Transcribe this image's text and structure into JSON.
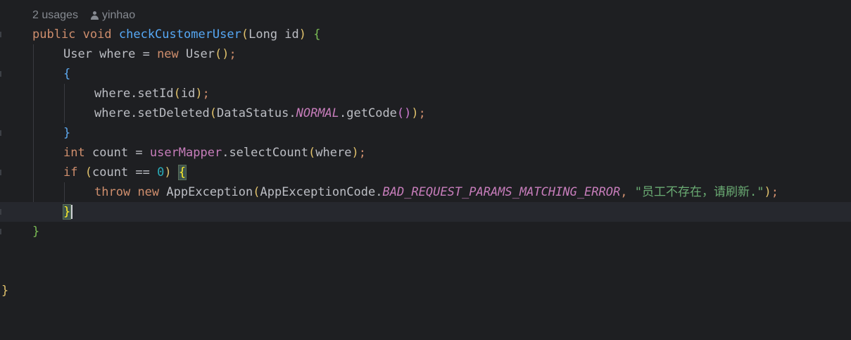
{
  "inlay_hint": {
    "usages": "2 usages",
    "author": "yinhao",
    "author_icon": "person-icon"
  },
  "code_lines": [
    [
      "public",
      " ",
      "void",
      " ",
      "checkCustomerUser",
      "(",
      "Long id",
      ")",
      " ",
      "{"
    ],
    [
      "User where = ",
      "new",
      " ",
      "User",
      "(",
      ")",
      ";"
    ],
    [
      "{"
    ],
    [
      "where.setId",
      "(",
      "id",
      ")",
      ";"
    ],
    [
      "where.setDeleted",
      "(",
      "DataStatus.",
      "NORMAL",
      ".getCode",
      "(",
      ")",
      ")",
      ";"
    ],
    [
      "}"
    ],
    [
      "int",
      " count = ",
      "userMapper",
      ".selectCount",
      "(",
      "where",
      ")",
      ";"
    ],
    [
      "if",
      " ",
      "(",
      "count == ",
      "0",
      ")",
      " ",
      "{"
    ],
    [
      "throw",
      " ",
      "new",
      " ",
      "AppException",
      "(",
      "AppExceptionCode.",
      "BAD_REQUEST_PARAMS_MATCHING_ERROR",
      ", ",
      "\"员工不存在，请刷新.\"",
      ")",
      ";"
    ],
    [
      "}"
    ],
    [
      "}"
    ],
    [
      ""
    ],
    [
      ""
    ],
    [
      "}"
    ]
  ],
  "colors": {
    "background": "#1e1f22",
    "current_line": "#26282e",
    "keyword": "#cf8e6d",
    "method": "#56a8f5",
    "field": "#c77dbb",
    "number": "#2aacb8",
    "string": "#6aab73"
  }
}
